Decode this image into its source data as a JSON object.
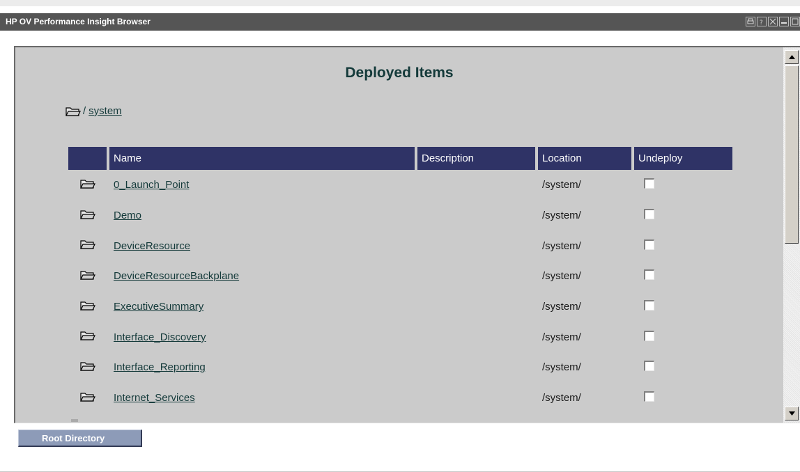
{
  "window": {
    "title": "HP OV Performance Insight Browser",
    "icons": [
      "print-icon",
      "help-icon",
      "close-icon",
      "minimize-icon",
      "maximize-icon"
    ]
  },
  "page": {
    "heading": "Deployed Items",
    "breadcrumb": {
      "separator": "/",
      "link": "system"
    }
  },
  "table": {
    "headers": {
      "name": "Name",
      "description": "Description",
      "location": "Location",
      "undeploy": "Undeploy"
    },
    "rows": [
      {
        "name": "0_Launch_Point",
        "description": "",
        "location": "/system/",
        "undeploy": false
      },
      {
        "name": "Demo",
        "description": "",
        "location": "/system/",
        "undeploy": false
      },
      {
        "name": "DeviceResource",
        "description": "",
        "location": "/system/",
        "undeploy": false
      },
      {
        "name": "DeviceResourceBackplane",
        "description": "",
        "location": "/system/",
        "undeploy": false
      },
      {
        "name": "ExecutiveSummary",
        "description": "",
        "location": "/system/",
        "undeploy": false
      },
      {
        "name": "Interface_Discovery",
        "description": "",
        "location": "/system/",
        "undeploy": false
      },
      {
        "name": "Interface_Reporting",
        "description": "",
        "location": "/system/",
        "undeploy": false
      },
      {
        "name": "Internet_Services",
        "description": "",
        "location": "/system/",
        "undeploy": false
      }
    ]
  },
  "buttons": {
    "root_directory": "Root Directory"
  },
  "colors": {
    "header_bg": "#2f3366",
    "frame_bg": "#cbcbcb",
    "titlebar_bg": "#555555",
    "button_bg": "#8d9bb8"
  }
}
